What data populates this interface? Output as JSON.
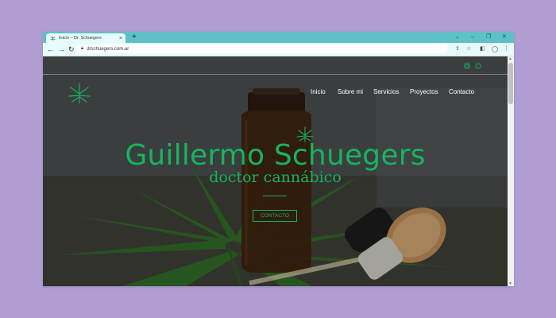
{
  "browser": {
    "tab_title": "Inicio – Dr. Schuegers",
    "tab_close": "×",
    "new_tab": "+",
    "url": "drschuegers.com.ar",
    "window_controls": {
      "dropdown": "⌄",
      "minimize": "–",
      "restore": "❐",
      "close": "✕"
    },
    "nav": {
      "back": "←",
      "forward": "→",
      "reload": "↻"
    },
    "toolbar": {
      "share": "⇪",
      "bookmark": "☆",
      "sidepanel": "◧",
      "menu": "⋮"
    },
    "icons": [
      "favicon-cannabis-icon",
      "lock-icon",
      "instagram-icon",
      "whatsapp-icon"
    ]
  },
  "site": {
    "menu": [
      "Inicio",
      "Sobre mi",
      "Servicios",
      "Proyectos",
      "Contacto"
    ],
    "hero_title": "Guillermo Schuegers",
    "hero_subtitle": "doctor cannábico",
    "cta": "CONTACTO"
  },
  "colors": {
    "accent": "#16b45e",
    "titlebar": "#5fc0c7",
    "background": "#b09ed3"
  }
}
